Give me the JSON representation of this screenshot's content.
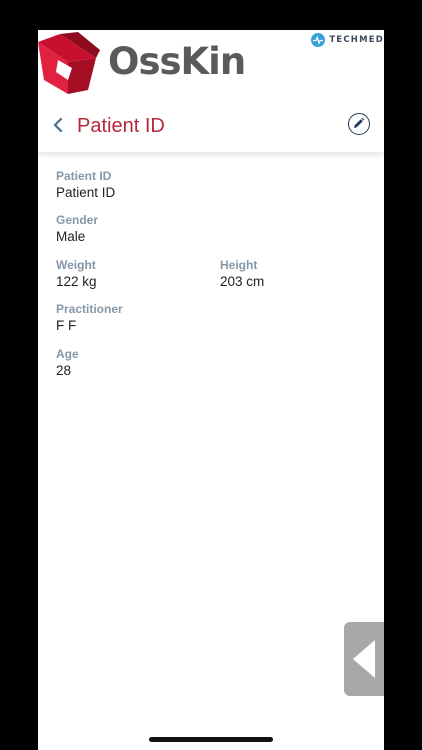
{
  "brand": {
    "name": "OssKin",
    "partner": "TECHMED"
  },
  "header": {
    "title": "Patient ID",
    "back_icon": "chevron-left-icon",
    "edit_icon": "pencil-icon"
  },
  "fields": {
    "patient_id": {
      "label": "Patient ID",
      "value": "Patient ID"
    },
    "gender": {
      "label": "Gender",
      "value": "Male"
    },
    "weight": {
      "label": "Weight",
      "value": "122 kg"
    },
    "height": {
      "label": "Height",
      "value": "203 cm"
    },
    "practitioner": {
      "label": "Practitioner",
      "value": "F F"
    },
    "age": {
      "label": "Age",
      "value": "28"
    }
  },
  "colors": {
    "accent": "#b8283a",
    "label": "#6f8599",
    "edit_icon": "#1f3b57",
    "techmed": "#3aa0d8"
  }
}
